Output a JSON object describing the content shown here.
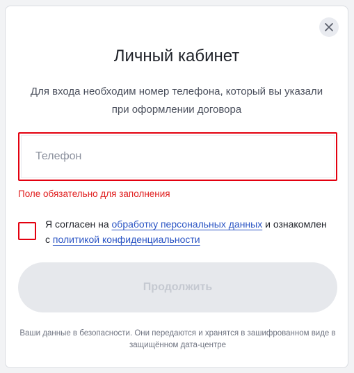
{
  "dialog": {
    "title": "Личный кабинет",
    "subtitle": "Для входа необходим номер телефона, который вы указали при оформлении договора",
    "close_icon": "close-icon",
    "phone": {
      "placeholder": "Телефон",
      "value": ""
    },
    "error_text": "Поле обязательно для заполнения",
    "consent": {
      "checked": false,
      "text_before": "Я согласен на",
      "link_personal_data": "обработку персональных данных",
      "text_middle": "и ознакомлен с",
      "link_privacy": "политикой конфиденциальности"
    },
    "continue_label": "Продолжить",
    "footer_text": "Ваши данные в безопасности. Они передаются и хранятся в зашифрованном виде в защищённом дата-центре",
    "colors": {
      "error": "#e3000f",
      "link": "#2a54c4",
      "button_disabled_bg": "#e6e8ec",
      "button_disabled_text": "#c5c9d1"
    }
  }
}
